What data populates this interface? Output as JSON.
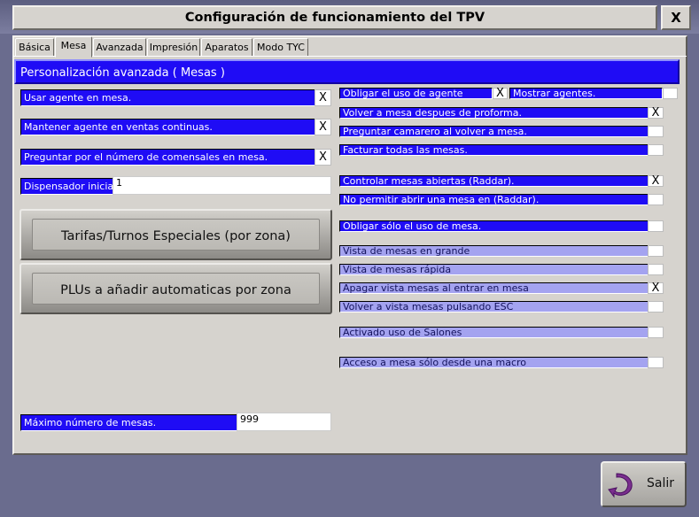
{
  "window": {
    "title": "Configuración de funcionamiento del TPV",
    "close_label": "X"
  },
  "tabs": [
    {
      "label": "Básica"
    },
    {
      "label": "Mesa"
    },
    {
      "label": "Avanzada"
    },
    {
      "label": "Impresión"
    },
    {
      "label": "Aparatos"
    },
    {
      "label": "Modo TYC"
    }
  ],
  "active_tab": "Mesa",
  "section_title": "Personalización avanzada ( Mesas )",
  "left_options": [
    {
      "label": "Usar agente en mesa.",
      "check": "X"
    },
    {
      "label": "Mantener agente en ventas continuas.",
      "check": "X"
    },
    {
      "label": "Preguntar por el número de comensales en mesa.",
      "check": "X"
    }
  ],
  "dispensador": {
    "label": "Dispensador inicial.",
    "value": "1"
  },
  "buttons": {
    "tarifas": "Tarifas/Turnos Especiales (por zona)",
    "plus": "PLUs a añadir automaticas por zona",
    "salir": "Salir"
  },
  "max_mesas": {
    "label": "Máximo número de mesas.",
    "value": "999"
  },
  "right_top": [
    {
      "label": "Obligar el uso de agente",
      "check": "X"
    },
    {
      "label": "Mostrar agentes.",
      "check": ""
    }
  ],
  "right_options": [
    {
      "label": "Volver a mesa despues de proforma.",
      "check": "X"
    },
    {
      "label": "Preguntar camarero al volver a mesa.",
      "check": ""
    },
    {
      "label": "Facturar todas las mesas.",
      "check": ""
    },
    {
      "label": "Controlar mesas abiertas (Raddar).",
      "check": "X"
    },
    {
      "label": "No permitir abrir una mesa en (Raddar).",
      "check": ""
    },
    {
      "label": "Obligar sólo el uso de mesa.",
      "check": ""
    },
    {
      "label": "Vista de mesas en grande",
      "check": ""
    },
    {
      "label": "Vista de mesas rápida",
      "check": ""
    },
    {
      "label": "Apagar vista mesas al entrar en mesa",
      "check": "X"
    },
    {
      "label": "Volver a vista mesas pulsando ESC",
      "check": ""
    },
    {
      "label": "Activado uso de Salones",
      "check": ""
    },
    {
      "label": "Acceso a mesa sólo desde una macro",
      "check": ""
    }
  ],
  "colors": {
    "label_dark": "#1f0cf5",
    "label_light": "#a4a3f0",
    "panel": "#d6d3ce",
    "background": "#6a6c8e"
  }
}
